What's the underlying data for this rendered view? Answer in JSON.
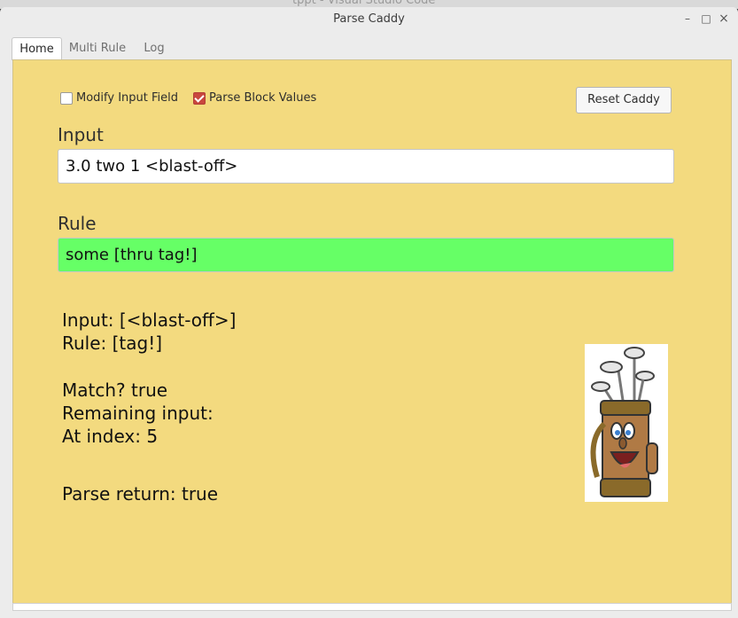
{
  "background": {
    "editor_title": "tppt - Visual Studio Code"
  },
  "window": {
    "title": "Parse Caddy",
    "minimize": "–",
    "maximize": "□",
    "close": "×"
  },
  "tabs": [
    {
      "label": "Home",
      "active": true
    },
    {
      "label": "Multi Rule",
      "active": false
    },
    {
      "label": "Log",
      "active": false
    }
  ],
  "options": {
    "modify_input": {
      "label": "Modify Input Field",
      "checked": false
    },
    "parse_block": {
      "label": "Parse Block Values",
      "checked": true
    },
    "reset_label": "Reset Caddy"
  },
  "input": {
    "label": "Input",
    "value": "3.0 two 1 <blast-off>"
  },
  "rule": {
    "label": "Rule",
    "value": "some [thru tag!]",
    "status_color": "#66ff66"
  },
  "output": {
    "input_line": "Input: [<blast-off>]",
    "rule_line": "Rule: [tag!]",
    "match_line": "Match? true",
    "remaining_line": "Remaining input:",
    "index_line": "At index: 5",
    "return_line": "Parse return: true"
  },
  "colors": {
    "panel": "#f3da7f",
    "rule_ok": "#66ff66",
    "checkbox_on": "#c9473e"
  },
  "icons": {
    "mascot": "golf-bag-caddy-image"
  }
}
